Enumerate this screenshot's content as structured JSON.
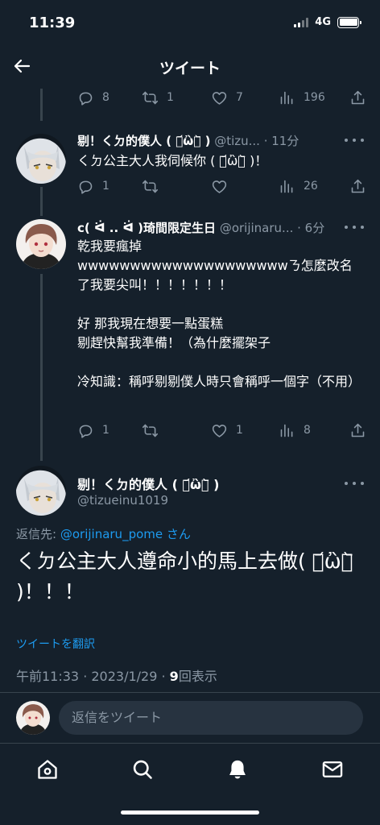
{
  "status_bar": {
    "time": "11:39",
    "network": "4G"
  },
  "header": {
    "title": "ツイート"
  },
  "tweet_prev_stats": {
    "replies": "8",
    "retweets": "1",
    "likes": "7",
    "views": "196"
  },
  "tweets": [
    {
      "name": "剔！くㄉ的僕人 ( ･᷄ὢ･᷅ )",
      "handle": "@tizu...",
      "time": "· 11分",
      "text": [
        "くㄉ公主大人我伺候你 ( ･᷄ὢ･᷅ )！"
      ],
      "replies": "1",
      "retweets": "",
      "likes": "",
      "views": "26"
    },
    {
      "name": "c( ᐛ .. ᐛ )琦間限定生日",
      "handle": "@orijinaru...",
      "time": "· 6分",
      "text": [
        "乾我要瘋掉",
        "wwwwwwwwwwwwwwwwwwwwㄋ怎麼改名了我要尖叫！！！！！！！",
        "",
        "好 那我現在想要一點蛋糕",
        "剔趕快幫我準備！（為什麼擺架子",
        "",
        "冷知識：稱呼剔剔僕人時只會稱呼一個字（不用）"
      ],
      "replies": "1",
      "retweets": "",
      "likes": "1",
      "views": "8"
    }
  ],
  "main_tweet": {
    "name": "剔！くㄉ的僕人 ( ･᷄ὢ･᷅ )",
    "handle": "@tizueinu1019",
    "reply_prefix": "返信先:",
    "reply_handle": "@orijinaru_pome",
    "reply_suffix": "さん",
    "text": "くㄉ公主大人遵命小的馬上去做( ･᷄ὢ･᷅ )！！！",
    "translate_label": "ツイートを翻訳",
    "timestamp": "午前11:33 · 2023/1/29 · ",
    "view_count": "9",
    "view_label": "回表示"
  },
  "reply_bar": {
    "placeholder": "返信をツイート"
  },
  "colors": {
    "background": "#15202b",
    "accent": "#1d9bf0",
    "secondary_text": "#8b98a5",
    "divider": "#38444d"
  },
  "icons": {
    "tabs": [
      "home-icon",
      "search-icon",
      "notifications-bell-icon",
      "messages-envelope-icon"
    ],
    "actions": [
      "reply-icon",
      "retweet-icon",
      "like-heart-icon",
      "views-chart-icon",
      "share-icon"
    ]
  }
}
